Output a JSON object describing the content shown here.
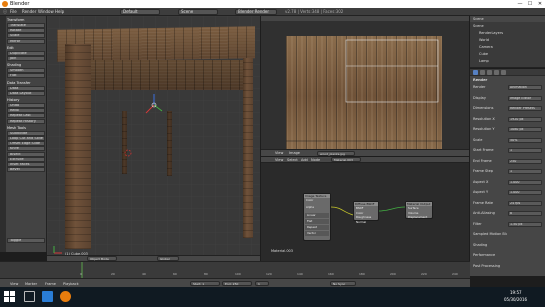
{
  "window": {
    "title": "Blender",
    "min": "—",
    "max": "☐",
    "close": "✕"
  },
  "menu": [
    "File",
    "Render",
    "Window",
    "Help"
  ],
  "header": {
    "layout": "Default",
    "scene": "Scene",
    "engine": "Blender Render",
    "stats": "v2.78 | Verts:348 | Faces:302"
  },
  "toolshelf": {
    "sections": [
      {
        "title": "Transform",
        "items": [
          "Translate",
          "Rotate",
          "Scale",
          "Mirror"
        ]
      },
      {
        "title": "Edit",
        "items": [
          "Duplicate",
          "Join"
        ]
      },
      {
        "title": "Shading",
        "items": [
          "Smooth",
          "Flat"
        ]
      },
      {
        "title": "Data Transfer",
        "items": [
          "Data",
          "Data Layout"
        ]
      },
      {
        "title": "History",
        "items": [
          "Undo",
          "Redo",
          "Repeat Last",
          "Repeat History"
        ]
      },
      {
        "title": "Mesh Tools",
        "items": [
          "Subdivide",
          "Loop Cut and Slide",
          "Offset Edge Slide",
          "Knife",
          "Bisect",
          "Extrude",
          "Inset Faces",
          "Bevel"
        ]
      }
    ],
    "last_op": "Toggle"
  },
  "viewport": {
    "label": "(1) Cube.003",
    "mode": "Object Mode",
    "pivot": "Global"
  },
  "image_editor": {
    "menu": [
      "View",
      "Image"
    ],
    "image": "wood_planks.jpg"
  },
  "node_editor": {
    "menu": [
      "View",
      "Select",
      "Add",
      "Node"
    ],
    "material": "Material.003",
    "nodes": [
      {
        "name": "Image Texture",
        "rows": [
          "Color",
          "Alpha",
          "Linear",
          "Flat",
          "Repeat",
          "Vector"
        ]
      },
      {
        "name": "Diffuse BSDF",
        "rows": [
          "BSDF",
          "Color",
          "Roughness",
          "Normal"
        ]
      },
      {
        "name": "Material Output",
        "rows": [
          "Surface",
          "Volume",
          "Displacement"
        ]
      }
    ],
    "status": "Material.003"
  },
  "outliner": {
    "title": "Scene",
    "items": [
      "Scene",
      "RenderLayers",
      "World",
      "Camera",
      "Cube",
      "Lamp"
    ]
  },
  "properties": {
    "section": "Render",
    "rows": [
      {
        "label": "Render",
        "value": "Animation"
      },
      {
        "label": "Display",
        "value": "Image Editor"
      },
      {
        "label": "Dimensions",
        "value": "Render Presets"
      },
      {
        "label": "Resolution X",
        "value": "1920 px"
      },
      {
        "label": "Resolution Y",
        "value": "1080 px"
      },
      {
        "label": "Scale",
        "value": "50%"
      },
      {
        "label": "Start Frame",
        "value": "1"
      },
      {
        "label": "End Frame",
        "value": "250"
      },
      {
        "label": "Frame Step",
        "value": "1"
      },
      {
        "label": "Aspect X",
        "value": "1.000"
      },
      {
        "label": "Aspect Y",
        "value": "1.000"
      },
      {
        "label": "Frame Rate",
        "value": "24 fps"
      },
      {
        "label": "Anti-Aliasing",
        "value": "8"
      },
      {
        "label": "Filter",
        "value": "1.50 px"
      },
      {
        "label": "Sampled Motion Blur",
        "value": ""
      },
      {
        "label": "Shading",
        "value": ""
      },
      {
        "label": "Performance",
        "value": ""
      },
      {
        "label": "Post Processing",
        "value": ""
      }
    ]
  },
  "timeline": {
    "menu": [
      "View",
      "Marker",
      "Frame",
      "Playback"
    ],
    "start": "Start: 1",
    "end": "End: 250",
    "current": "1",
    "sync": "No Sync",
    "ticks": [
      "0",
      "20",
      "40",
      "60",
      "80",
      "100",
      "120",
      "140",
      "160",
      "180",
      "200",
      "220",
      "240"
    ]
  },
  "taskbar": {
    "time": "19:57",
    "date": "05/30/2016"
  },
  "colors": {
    "accent": "#e87d0d",
    "selected": "#5680c2",
    "taskbar": "#101a22"
  }
}
